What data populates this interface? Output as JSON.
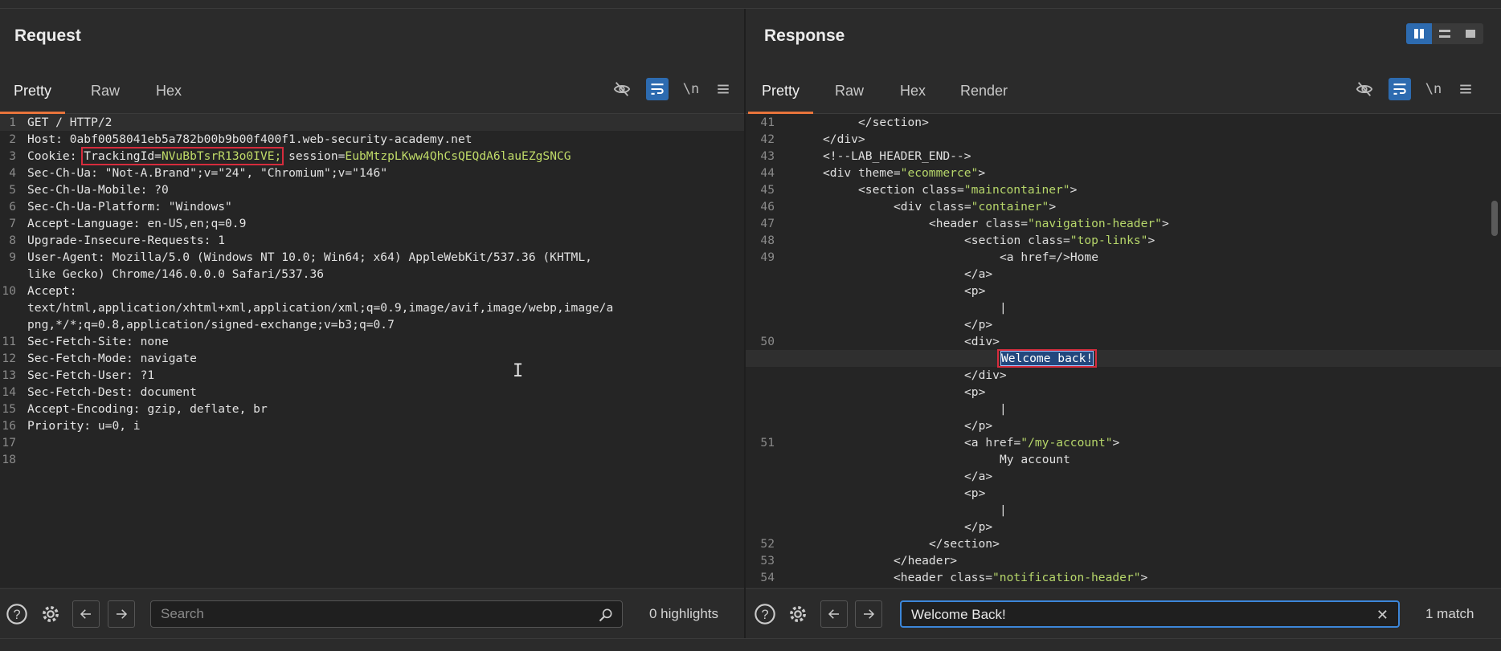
{
  "request": {
    "title": "Request",
    "tabs": [
      "Pretty",
      "Raw",
      "Hex"
    ],
    "active_tab": "Pretty",
    "toolbar_icons": [
      "eye-off-icon",
      "wrap-icon",
      "newline-toggle",
      "menu-icon"
    ],
    "newline_label": "\\n",
    "lines": [
      {
        "n": "1",
        "t": "GET / HTTP/2"
      },
      {
        "n": "2",
        "k": "Host: ",
        "v": "0abf0058041eb5a782b00b9b00f400f1.web-security-academy.net"
      },
      {
        "n": "3",
        "k": "Cookie: ",
        "c1": "TrackingId=",
        "c1v": "NVuBbTsrR13o0IVE;",
        "c2": " session=",
        "c2v": "EubMtzpLKww4QhCsQEQdA6lauEZgSNCG"
      },
      {
        "n": "4",
        "k": "Sec-Ch-Ua: ",
        "v": "\"Not-A.Brand\";v=\"24\", \"Chromium\";v=\"146\""
      },
      {
        "n": "5",
        "k": "Sec-Ch-Ua-Mobile: ",
        "v": "?0"
      },
      {
        "n": "6",
        "k": "Sec-Ch-Ua-Platform: ",
        "v": "\"Windows\""
      },
      {
        "n": "7",
        "k": "Accept-Language: ",
        "v": "en-US,en;q=0.9"
      },
      {
        "n": "8",
        "k": "Upgrade-Insecure-Requests: ",
        "v": "1"
      },
      {
        "n": "9",
        "k": "User-Agent: ",
        "v": "Mozilla/5.0 (Windows NT 10.0; Win64; x64) AppleWebKit/537.36 (KHTML,"
      },
      {
        "n": "",
        "t": "like Gecko) Chrome/146.0.0.0 Safari/537.36"
      },
      {
        "n": "10",
        "k": "Accept:"
      },
      {
        "n": "",
        "t": "text/html,application/xhtml+xml,application/xml;q=0.9,image/avif,image/webp,image/a"
      },
      {
        "n": "",
        "t": "png,*/*;q=0.8,application/signed-exchange;v=b3;q=0.7"
      },
      {
        "n": "11",
        "k": "Sec-Fetch-Site: ",
        "v": "none"
      },
      {
        "n": "12",
        "k": "Sec-Fetch-Mode: ",
        "v": "navigate"
      },
      {
        "n": "13",
        "k": "Sec-Fetch-User: ",
        "v": "?1"
      },
      {
        "n": "14",
        "k": "Sec-Fetch-Dest: ",
        "v": "document"
      },
      {
        "n": "15",
        "k": "Accept-Encoding: ",
        "v": "gzip, deflate, br"
      },
      {
        "n": "16",
        "k": "Priority: ",
        "v": "u=0, i"
      },
      {
        "n": "17",
        "t": ""
      },
      {
        "n": "18",
        "t": ""
      }
    ],
    "search_placeholder": "Search",
    "search_status": "0 highlights"
  },
  "response": {
    "title": "Response",
    "tabs": [
      "Pretty",
      "Raw",
      "Hex",
      "Render"
    ],
    "active_tab": "Pretty",
    "toolbar_icons": [
      "eye-off-icon",
      "wrap-icon",
      "newline-toggle",
      "menu-icon"
    ],
    "newline_label": "\\n",
    "lines": [
      {
        "n": "41",
        "i": 4,
        "t": "</section>"
      },
      {
        "n": "42",
        "i": 2,
        "t": "</div>"
      },
      {
        "n": "43",
        "i": 2,
        "t": "<!--LAB_HEADER_END-->"
      },
      {
        "n": "44",
        "i": 2,
        "tag": "<div ",
        "an": "theme=",
        "av": "\"ecommerce\"",
        "end": ">"
      },
      {
        "n": "45",
        "i": 4,
        "tag": "<section ",
        "an": "class=",
        "av": "\"maincontainer\"",
        "end": ">"
      },
      {
        "n": "46",
        "i": 6,
        "tag": "<div ",
        "an": "class=",
        "av": "\"container\"",
        "end": ">"
      },
      {
        "n": "47",
        "i": 8,
        "tag": "<header ",
        "an": "class=",
        "av": "\"navigation-header\"",
        "end": ">"
      },
      {
        "n": "48",
        "i": 10,
        "tag": "<section ",
        "an": "class=",
        "av": "\"top-links\"",
        "end": ">"
      },
      {
        "n": "49",
        "i": 12,
        "t": "<a href=/>Home"
      },
      {
        "n": "",
        "i": 10,
        "t": "</a>"
      },
      {
        "n": "",
        "i": 10,
        "t": "<p>"
      },
      {
        "n": "",
        "i": 12,
        "t": "|"
      },
      {
        "n": "",
        "i": 10,
        "t": "</p>"
      },
      {
        "n": "50",
        "i": 10,
        "t": "<div>"
      },
      {
        "n": "",
        "i": 12,
        "sel": "Welcome back!",
        "hl": true
      },
      {
        "n": "",
        "i": 10,
        "t": "</div>"
      },
      {
        "n": "",
        "i": 10,
        "t": "<p>"
      },
      {
        "n": "",
        "i": 12,
        "t": "|"
      },
      {
        "n": "",
        "i": 10,
        "t": "</p>"
      },
      {
        "n": "51",
        "i": 10,
        "tag": "<a ",
        "an": "href=",
        "av": "\"/my-account\"",
        "end": ">"
      },
      {
        "n": "",
        "i": 12,
        "t": "My account"
      },
      {
        "n": "",
        "i": 10,
        "t": "</a>"
      },
      {
        "n": "",
        "i": 10,
        "t": "<p>"
      },
      {
        "n": "",
        "i": 12,
        "t": "|"
      },
      {
        "n": "",
        "i": 10,
        "t": "</p>"
      },
      {
        "n": "52",
        "i": 8,
        "t": "</section>"
      },
      {
        "n": "53",
        "i": 6,
        "t": "</header>"
      },
      {
        "n": "54",
        "i": 6,
        "tag": "<header ",
        "an": "class=",
        "av": "\"notification-header\"",
        "end": ">"
      }
    ],
    "search_value": "Welcome Back!",
    "search_status": "1 match"
  }
}
